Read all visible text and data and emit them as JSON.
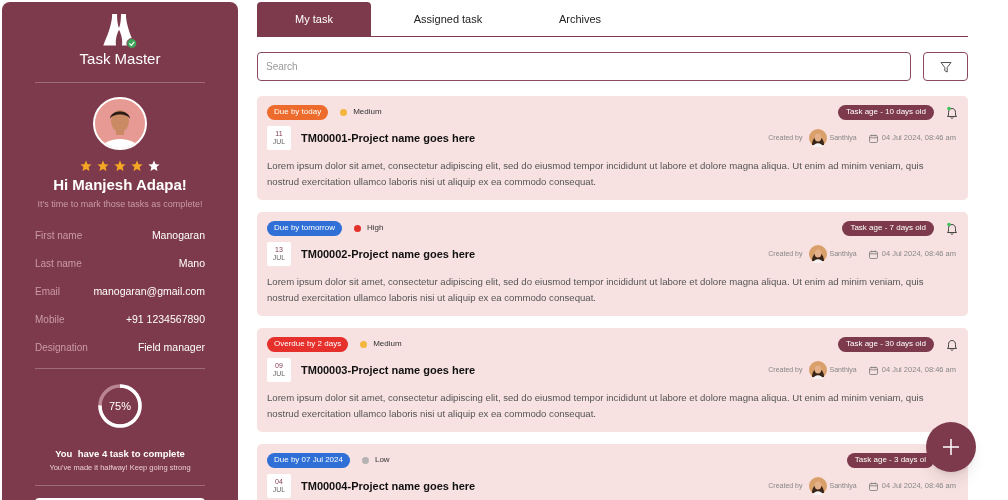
{
  "app": {
    "title": "Task Master"
  },
  "profile": {
    "stars": 4,
    "greeting": "Hi Manjesh Adapa!",
    "subtitle": "It's time to mark those tasks as complete!",
    "fields": [
      {
        "label": "First name",
        "value": "Manogaran"
      },
      {
        "label": "Last name",
        "value": "Mano"
      },
      {
        "label": "Email",
        "value": "manogaran@gmail.com"
      },
      {
        "label": "Mobile",
        "value": "+91 1234567890"
      },
      {
        "label": "Designation",
        "value": "Field manager"
      }
    ]
  },
  "progress": {
    "label": "75%",
    "title": "You  have 4 task to complete",
    "subtitle": "You've made it halfway! Keep going strong"
  },
  "tabs": [
    {
      "label": "My task",
      "selected": true
    },
    {
      "label": "Assigned task",
      "selected": false
    },
    {
      "label": "Archives",
      "selected": false
    }
  ],
  "search": {
    "placeholder": "Search"
  },
  "tasks": [
    {
      "due": {
        "label": "Due by today",
        "color": "#ec6b2d"
      },
      "priority": {
        "label": "Medium",
        "color": "#f4b63f"
      },
      "age": "Task age - 10 days old",
      "notification": true,
      "day": "11",
      "month": "JUL",
      "title": "TM00001-Project name goes here",
      "created_by_label": "Created by",
      "creator": "Santhiya",
      "date": "04 Jul 2024, 08:46 am",
      "description": "Lorem ipsum dolor sit amet, consectetur adipiscing elit, sed do eiusmod tempor incididunt ut labore et dolore magna aliqua. Ut enim ad minim veniam, quis nostrud exercitation ullamco laboris nisi ut aliquip ex ea commodo consequat."
    },
    {
      "due": {
        "label": "Due by tomorrow",
        "color": "#2f6fd6"
      },
      "priority": {
        "label": "High",
        "color": "#e2302a"
      },
      "age": "Task age - 7 days old",
      "notification": true,
      "day": "13",
      "month": "JUL",
      "title": "TM00002-Project name goes here",
      "created_by_label": "Created by",
      "creator": "Santhiya",
      "date": "04 Jul 2024, 08:46 am",
      "description": "Lorem ipsum dolor sit amet, consectetur adipiscing elit, sed do eiusmod tempor incididunt ut labore et dolore magna aliqua. Ut enim ad minim veniam, quis nostrud exercitation ullamco laboris nisi ut aliquip ex ea commodo consequat."
    },
    {
      "due": {
        "label": "Overdue by 2 days",
        "color": "#e6302b"
      },
      "priority": {
        "label": "Medium",
        "color": "#f4b63f"
      },
      "age": "Task age - 30 days old",
      "notification": false,
      "day": "09",
      "month": "JUL",
      "title": "TM00003-Project name goes here",
      "created_by_label": "Created by",
      "creator": "Santhiya",
      "date": "04 Jul 2024, 08:46 am",
      "description": "Lorem ipsum dolor sit amet, consectetur adipiscing elit, sed do eiusmod tempor incididunt ut labore et dolore magna aliqua. Ut enim ad minim veniam, quis nostrud exercitation ullamco laboris nisi ut aliquip ex ea commodo consequat."
    },
    {
      "due": {
        "label": "Due by 07 Jul 2024",
        "color": "#2f6fd6"
      },
      "priority": {
        "label": "Low",
        "color": "#b4b4b4"
      },
      "age": "Task age - 3 days ol",
      "day": "04",
      "month": "JUL",
      "title": "TM00004-Project name goes here",
      "created_by_label": "Created by",
      "creator": "Santhiya",
      "date": "04 Jul 2024, 08:46 am"
    }
  ]
}
